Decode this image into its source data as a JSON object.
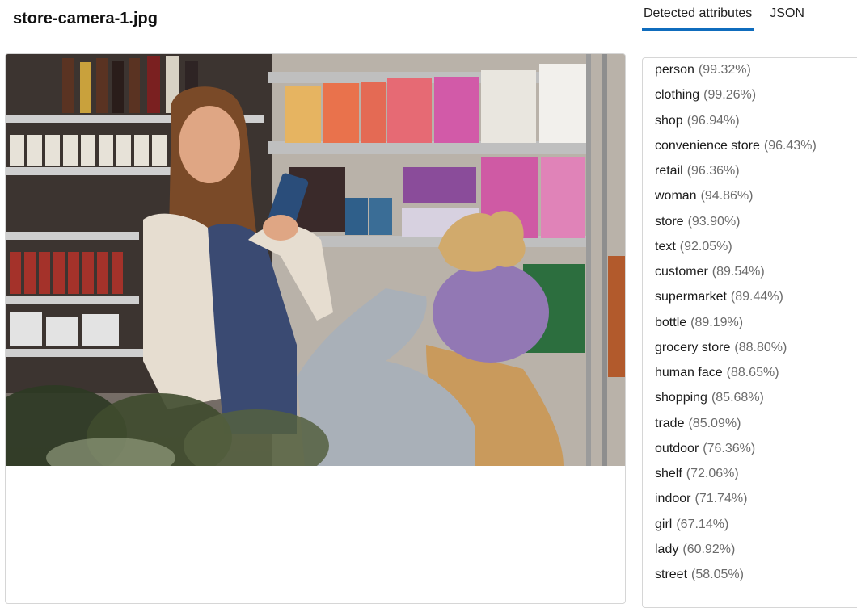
{
  "file": {
    "name": "store-camera-1.jpg"
  },
  "tabs": [
    {
      "label": "Detected attributes",
      "active": true
    },
    {
      "label": "JSON",
      "active": false
    }
  ],
  "attributes": [
    {
      "name": "person",
      "confidence": "(99.32%)"
    },
    {
      "name": "clothing",
      "confidence": "(99.26%)"
    },
    {
      "name": "shop",
      "confidence": "(96.94%)"
    },
    {
      "name": "convenience store",
      "confidence": "(96.43%)"
    },
    {
      "name": "retail",
      "confidence": "(96.36%)"
    },
    {
      "name": "woman",
      "confidence": "(94.86%)"
    },
    {
      "name": "store",
      "confidence": "(93.90%)"
    },
    {
      "name": "text",
      "confidence": "(92.05%)"
    },
    {
      "name": "customer",
      "confidence": "(89.54%)"
    },
    {
      "name": "supermarket",
      "confidence": "(89.44%)"
    },
    {
      "name": "bottle",
      "confidence": "(89.19%)"
    },
    {
      "name": "grocery store",
      "confidence": "(88.80%)"
    },
    {
      "name": "human face",
      "confidence": "(88.65%)"
    },
    {
      "name": "shopping",
      "confidence": "(85.68%)"
    },
    {
      "name": "trade",
      "confidence": "(85.09%)"
    },
    {
      "name": "outdoor",
      "confidence": "(76.36%)"
    },
    {
      "name": "shelf",
      "confidence": "(72.06%)"
    },
    {
      "name": "indoor",
      "confidence": "(71.74%)"
    },
    {
      "name": "girl",
      "confidence": "(67.14%)"
    },
    {
      "name": "lady",
      "confidence": "(60.92%)"
    },
    {
      "name": "street",
      "confidence": "(58.05%)"
    }
  ],
  "colors": {
    "accent": "#0f6cbd",
    "percent_text": "#6b6b6b",
    "border": "#d6d6d6"
  }
}
